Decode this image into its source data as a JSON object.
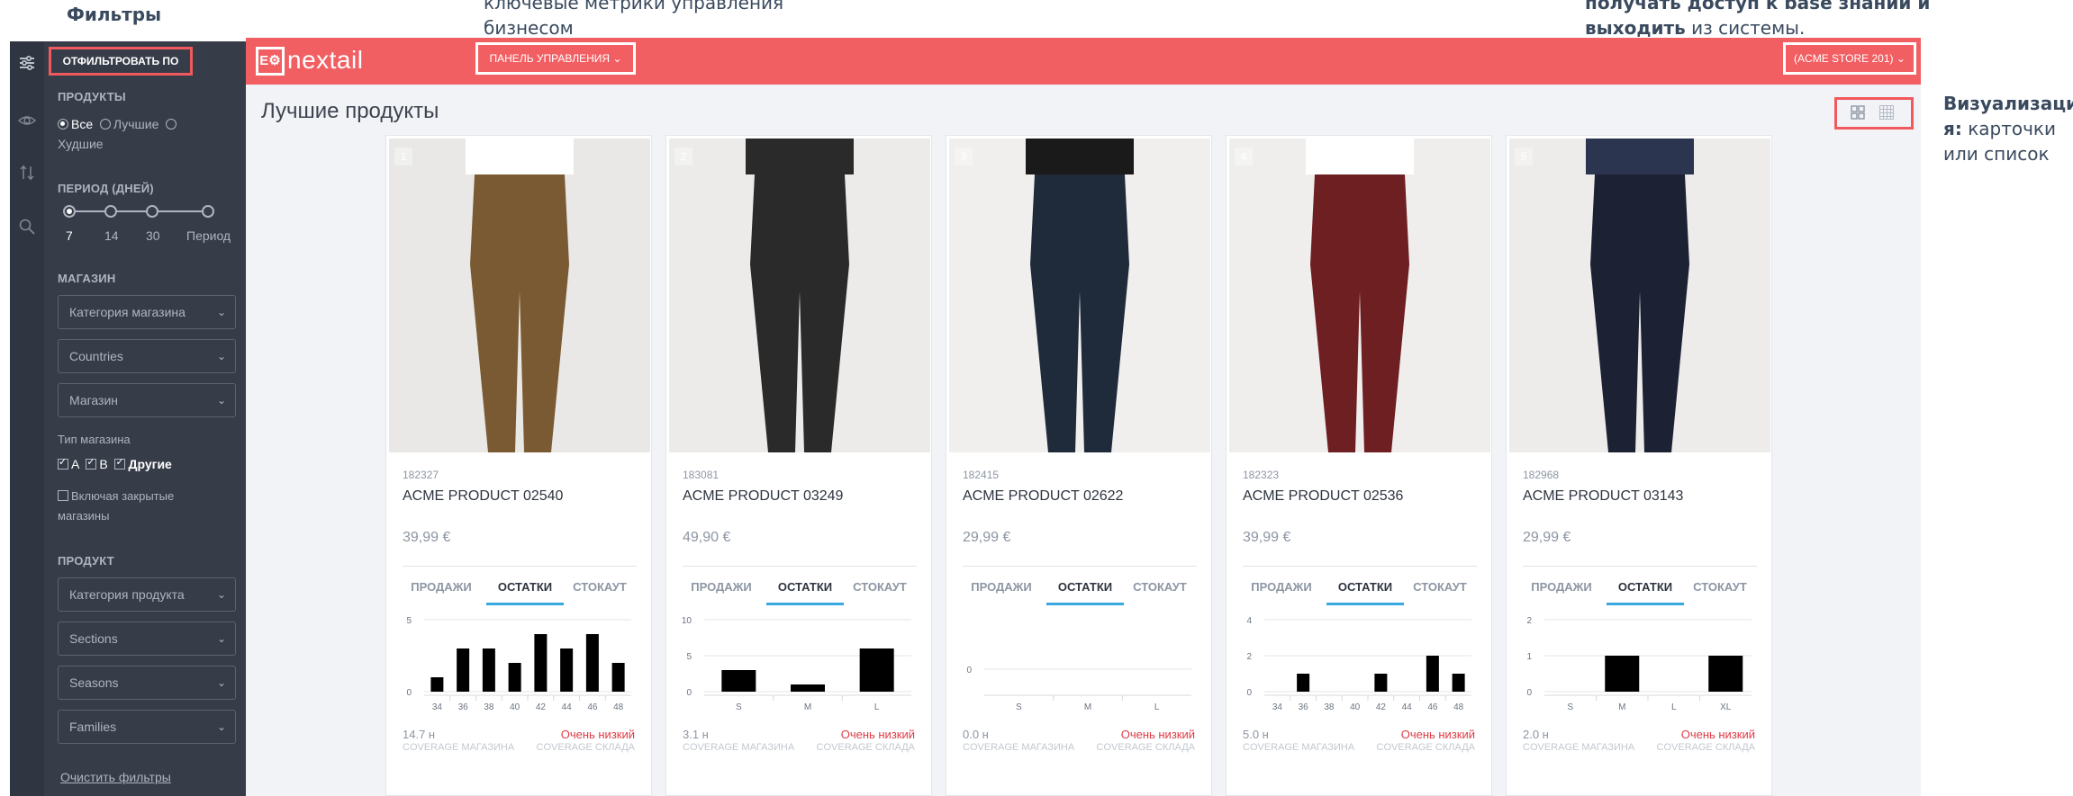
{
  "annotations": {
    "filters": "Фильтры",
    "metrics_line1": "ключевые метрики управления",
    "metrics_line2": "бизнесом",
    "kb_line1_bold": "получать доступ к base знаний и",
    "kb_line2_bold": "выходить",
    "kb_line2_rest": " из системы.",
    "view_bold1": "Визуализаци",
    "view_bold2": "я:",
    "view_rest2": " карточки",
    "view_line3": "или список"
  },
  "rail": {
    "icons": [
      "sliders-icon",
      "eye-icon",
      "sort-arrows-icon",
      "search-icon"
    ]
  },
  "sidebar": {
    "filter_by": "ОТФИЛЬТРОВАТЬ ПО",
    "products_label": "ПРОДУКТЫ",
    "radio_all": "Все",
    "radio_best": "Лучшие",
    "radio_worst": "Худшие",
    "period_label": "ПЕРИОД (ДНЕЙ)",
    "period_options": [
      "7",
      "14",
      "30",
      "Период"
    ],
    "store_label": "МАГАЗИН",
    "store_category": "Категория магазина",
    "countries": "Countries",
    "store": "Магазин",
    "store_type_label": "Тип магазина",
    "type_a": "A",
    "type_b": "B",
    "type_other": "Другие",
    "include_closed": "Включая закрытые",
    "include_closed_2": "магазины",
    "product_label": "ПРОДУКТ",
    "product_category": "Категория продукта",
    "sections": "Sections",
    "seasons": "Seasons",
    "families": "Families",
    "clear": "Очистить фильтры"
  },
  "header": {
    "logo_mark": "E⚙",
    "logo_text": "nextail",
    "panel": "ПАНЕЛЬ УПРАВЛЕНИЯ",
    "store": "(ACME STORE 201)"
  },
  "main": {
    "title": "Лучшие продукты",
    "tabs": [
      "ПРОДАЖИ",
      "ОСТАТКИ",
      "СТОКАУТ"
    ],
    "coverage_store": "COVERAGE МАГАЗИНА",
    "coverage_wh": "COVERAGE СКЛАДА"
  },
  "products": [
    {
      "rank": "1",
      "id": "182327",
      "name": "ACME PRODUCT 02540",
      "price": "39,99 €",
      "coverage": "14.7 н",
      "status": "Очень низкий",
      "img": {
        "bg": "#e9e8e6",
        "garment": "#7a5a32",
        "top": "#ffffff",
        "skin": "#e8c9a8"
      }
    },
    {
      "rank": "2",
      "id": "183081",
      "name": "ACME PRODUCT 03249",
      "price": "49,90 €",
      "coverage": "3.1 н",
      "status": "Очень низкий",
      "img": {
        "bg": "#ecebe9",
        "garment": "#2a2a2a",
        "top": "#2a2a2a",
        "skin": "#e8c9a8"
      }
    },
    {
      "rank": "3",
      "id": "182415",
      "name": "ACME PRODUCT 02622",
      "price": "29,99 €",
      "coverage": "0.0 н",
      "status": "Очень низкий",
      "img": {
        "bg": "#f0efed",
        "garment": "#1f2a3a",
        "top": "#1a1a1a",
        "skin": "#eccfb0"
      }
    },
    {
      "rank": "4",
      "id": "182323",
      "name": "ACME PRODUCT 02536",
      "price": "39,99 €",
      "coverage": "5.0 н",
      "status": "Очень низкий",
      "img": {
        "bg": "#efeeec",
        "garment": "#6e1f22",
        "top": "#ffffff",
        "skin": "#e8c9a8"
      }
    },
    {
      "rank": "5",
      "id": "182968",
      "name": "ACME PRODUCT 03143",
      "price": "29,99 €",
      "coverage": "2.0 н",
      "status": "Очень низкий",
      "img": {
        "bg": "#edecea",
        "garment": "#1c2233",
        "top": "#2c3550",
        "skin": "#e8c9a8"
      }
    }
  ],
  "chart_data": [
    {
      "type": "bar",
      "categories": [
        "34",
        "36",
        "38",
        "40",
        "42",
        "44",
        "46",
        "48"
      ],
      "values": [
        1,
        3,
        3,
        2,
        4,
        3,
        4,
        2
      ],
      "ylim": [
        0,
        5
      ],
      "yticks": [
        "5",
        "0"
      ]
    },
    {
      "type": "bar",
      "categories": [
        "S",
        "M",
        "L"
      ],
      "values": [
        3,
        1,
        6
      ],
      "ylim": [
        0,
        10
      ],
      "yticks": [
        "10",
        "5",
        "0"
      ]
    },
    {
      "type": "bar",
      "categories": [
        "S",
        "M",
        "L"
      ],
      "values": [
        0,
        0,
        0
      ],
      "ylim": [
        0,
        1
      ],
      "yticks": [
        "0"
      ]
    },
    {
      "type": "bar",
      "categories": [
        "34",
        "36",
        "38",
        "40",
        "42",
        "44",
        "46",
        "48"
      ],
      "values": [
        0,
        1,
        0,
        0,
        1,
        0,
        2,
        1
      ],
      "ylim": [
        0,
        4
      ],
      "yticks": [
        "4",
        "2",
        "0"
      ]
    },
    {
      "type": "bar",
      "categories": [
        "S",
        "M",
        "L",
        "XL"
      ],
      "values": [
        0,
        1,
        0,
        1
      ],
      "ylim": [
        0,
        2
      ],
      "yticks": [
        "2",
        "1",
        "0"
      ]
    }
  ]
}
